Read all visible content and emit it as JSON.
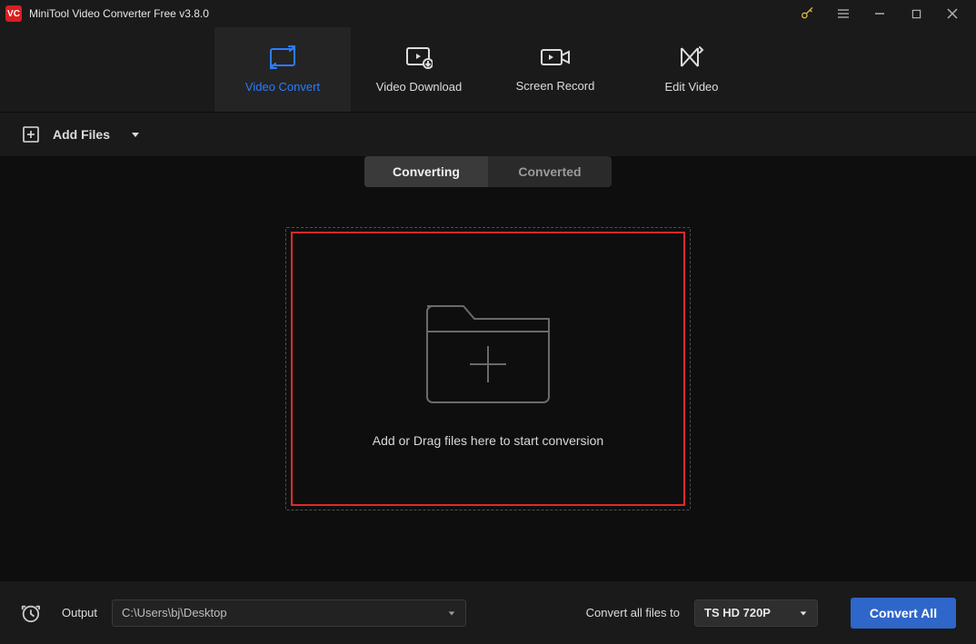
{
  "titlebar": {
    "title": "MiniTool Video Converter Free v3.8.0"
  },
  "main_tabs": {
    "convert": "Video Convert",
    "download": "Video Download",
    "record": "Screen Record",
    "edit": "Edit Video"
  },
  "toolbar": {
    "add_files": "Add Files",
    "seg_converting": "Converting",
    "seg_converted": "Converted"
  },
  "dropzone": {
    "hint": "Add or Drag files here to start conversion"
  },
  "bottom": {
    "output_label": "Output",
    "output_path": "C:\\Users\\bj\\Desktop",
    "convert_all_label": "Convert all files to",
    "format_selected": "TS HD 720P",
    "convert_all_btn": "Convert All"
  }
}
